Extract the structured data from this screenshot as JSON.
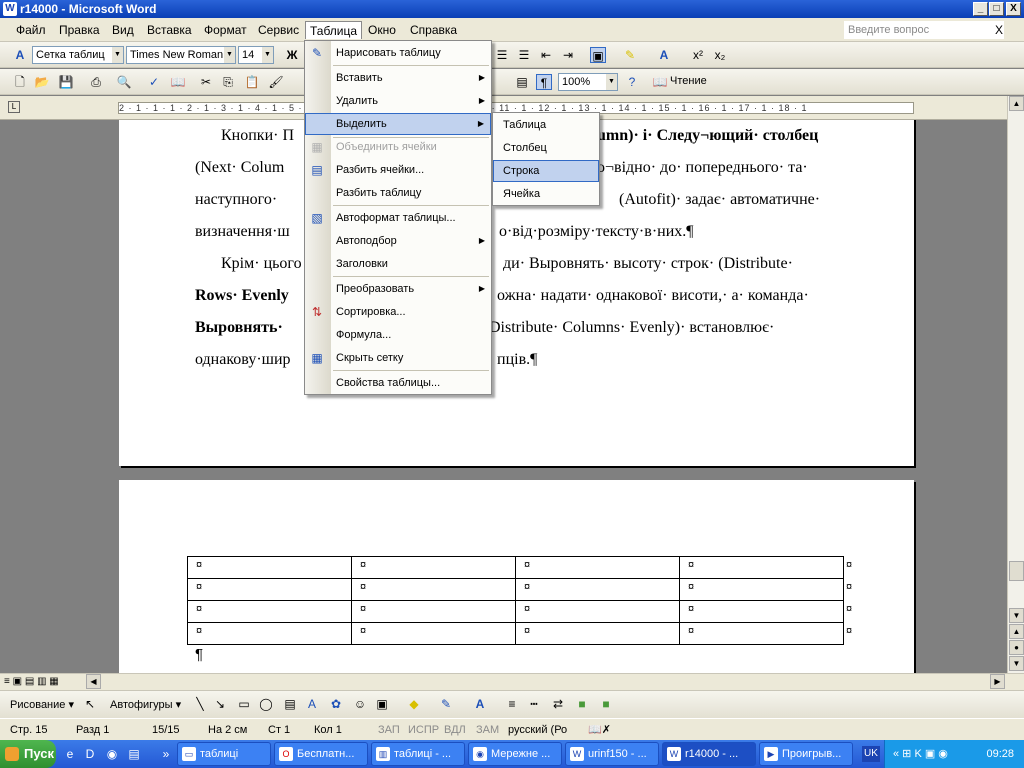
{
  "window": {
    "title": "r14000 - Microsoft Word",
    "min": "_",
    "max": "□",
    "close": "X"
  },
  "menubar": {
    "items": [
      "Файл",
      "Правка",
      "Вид",
      "Вставка",
      "Формат",
      "Сервис",
      "Таблица",
      "Окно",
      "Справка"
    ],
    "ask_placeholder": "Введите вопрос",
    "close_doc": "X"
  },
  "toolbar_format": {
    "style": "Сетка таблиц",
    "font": "Times New Roman",
    "size": "14",
    "bold": "Ж"
  },
  "toolbar_std": {
    "zoom": "100%",
    "reading": "Чтение"
  },
  "ruler": {
    "marks": "2 · 1 · 1 · 1 · 2 · 1 · 3 · 1 · 4 · 1 · 5 · 1 · 6 · 1 · 7 · 1 · 8 · 1 · 9 · 1 · 10 · 1 · 11 · 1 · 12 · 1 · 13 · 1 · 14 · 1 · 15 · 1 · 16 · 1 · 17 · 1 · 18 · 1"
  },
  "document": {
    "lines": [
      "Кнопки· П",
      "umn)· і· Следу¬ющий· столбец",
      "(Next· Colum",
      "о¬відно· до· попереднього· та·",
      "наступного·",
      "(Autofit)· задає· автоматичне·",
      "визначення·ш",
      "о·від·розміру·тексту·в·них.¶",
      "Крім· цього",
      "ди· Выровнять· высоту· строк· (Distribute·",
      "Rows· Evenly",
      "ожна· надати· однакової· висоти,· а· команда·",
      "Выровнять·",
      "Distribute· Columns· Evenly)· встановлює·",
      "однакову·шир",
      "пців.¶"
    ],
    "table_cell_mark": "¤",
    "para_mark": "¶",
    "rows": 4,
    "cols": 4
  },
  "table_menu": {
    "items": [
      {
        "label": "Нарисовать таблицу",
        "icon": "pencil-table-icon",
        "glyph": "✎"
      },
      {
        "label": "Вставить",
        "sub": "▶"
      },
      {
        "label": "Удалить",
        "sub": "▶"
      },
      {
        "label": "Выделить",
        "sub": "▶"
      },
      {
        "label": "Объединить ячейки",
        "icon": "merge-cells-icon",
        "glyph": "▦"
      },
      {
        "label": "Разбить ячейки...",
        "icon": "split-cells-icon",
        "glyph": "▤"
      },
      {
        "label": "Разбить таблицу"
      },
      {
        "label": "Автоформат таблицы...",
        "icon": "autoformat-icon",
        "glyph": "▧"
      },
      {
        "label": "Автоподбор",
        "sub": "▶"
      },
      {
        "label": "Заголовки"
      },
      {
        "label": "Преобразовать",
        "sub": "▶"
      },
      {
        "label": "Сортировка...",
        "icon": "sort-icon",
        "glyph": "⇅"
      },
      {
        "label": "Формула..."
      },
      {
        "label": "Скрыть сетку",
        "icon": "grid-icon",
        "glyph": "▦"
      },
      {
        "label": "Свойства таблицы..."
      }
    ]
  },
  "select_submenu": {
    "items": [
      "Таблица",
      "Столбец",
      "Строка",
      "Ячейка"
    ]
  },
  "drawbar": {
    "draw": "Рисование ▾",
    "autoshapes": "Автофигуры ▾"
  },
  "status": {
    "page": "Стр.  15",
    "section": "Разд  1",
    "pages": "15/15",
    "at": "На  2 см",
    "line": "Ст  1",
    "col": "Кол  1",
    "rec": "ЗАП",
    "trk": "ИСПР",
    "ext": "ВДЛ",
    "ovr": "ЗАМ",
    "lang": "русский (Ро"
  },
  "taskbar": {
    "start": "Пуск",
    "tasks": [
      "таблиці",
      "Бесплатн...",
      "таблиці - ...",
      "Мережне ...",
      "urinf150 - ...",
      "r14000 - ...",
      "Проигрыв..."
    ],
    "lang": "UK",
    "clock": "09:28"
  }
}
